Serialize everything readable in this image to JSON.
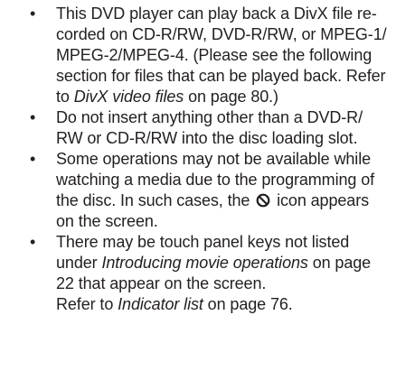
{
  "bullet_char": "•",
  "items": [
    {
      "lines": [
        {
          "pre": "This DVD player can play back a DivX file re-"
        },
        {
          "pre": "corded on CD-R/RW, DVD-R/RW, or MPEG-1/"
        },
        {
          "pre": "MPEG-2/MPEG-4. (Please see the following"
        },
        {
          "pre": "section for files that can be played back. Refer"
        },
        {
          "pre": "to ",
          "em": "DivX video files",
          "post": " on page 80.)"
        }
      ]
    },
    {
      "lines": [
        {
          "pre": "Do not insert anything other than a DVD-R/"
        },
        {
          "pre": "RW or CD-R/RW into the disc loading slot."
        }
      ]
    },
    {
      "lines": [
        {
          "pre": "Some operations may not be available while"
        },
        {
          "pre": "watching a media due to the programming of"
        },
        {
          "pre": "the disc. In such cases, the ",
          "post": " icon appears"
        },
        {
          "pre": "on the screen."
        }
      ]
    },
    {
      "lines": [
        {
          "pre": "There may be touch panel keys not listed"
        },
        {
          "pre": "under ",
          "em": "Introducing movie operations",
          "post": " on page"
        },
        {
          "pre": "22 that appear on the screen."
        },
        {
          "pre": "Refer to ",
          "em": "Indicator list",
          "post": " on page 76."
        }
      ]
    }
  ],
  "icons": {
    "prohibited": "prohibited-icon"
  }
}
